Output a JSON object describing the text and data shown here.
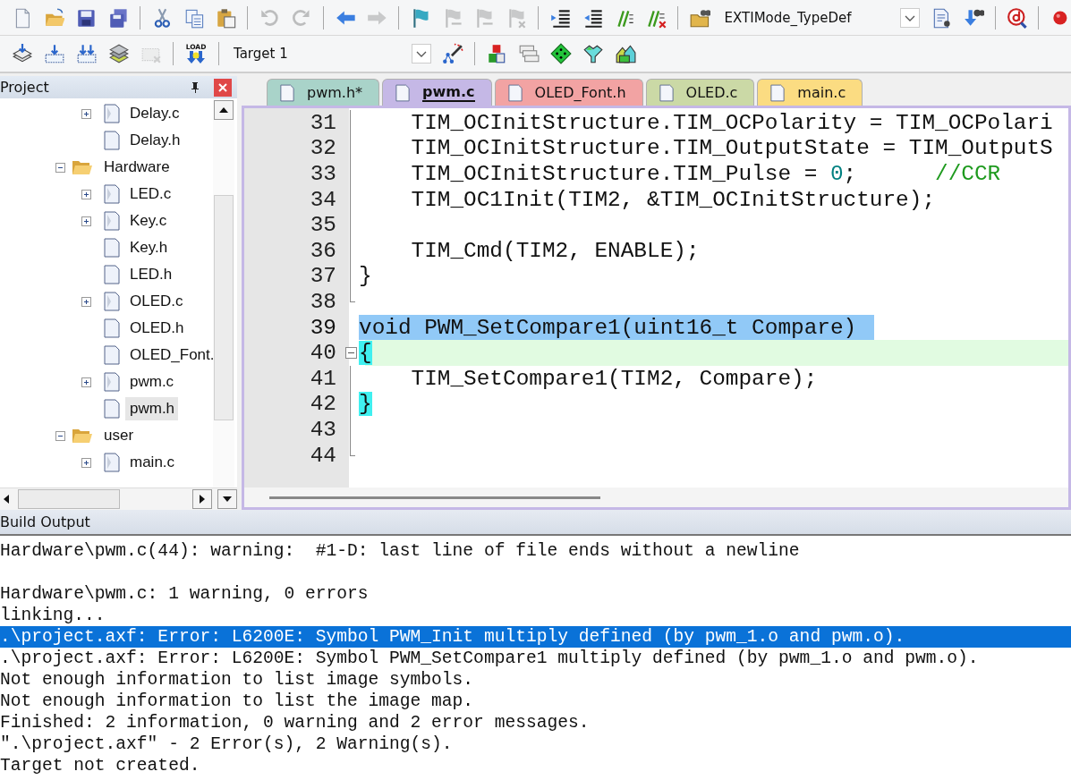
{
  "toolbar_rows": [
    [
      {
        "kind": "new",
        "disabled": false
      },
      {
        "kind": "open",
        "disabled": false
      },
      {
        "kind": "save",
        "disabled": false
      },
      {
        "kind": "save_all",
        "disabled": false
      },
      {
        "kind": "separator"
      },
      {
        "kind": "cut",
        "disabled": false
      },
      {
        "kind": "copy",
        "disabled": false
      },
      {
        "kind": "paste",
        "disabled": false
      },
      {
        "kind": "separator"
      },
      {
        "kind": "undo",
        "disabled": true
      },
      {
        "kind": "redo",
        "disabled": true
      },
      {
        "kind": "separator"
      },
      {
        "kind": "back",
        "disabled": false
      },
      {
        "kind": "forward",
        "disabled": true
      },
      {
        "kind": "separator"
      },
      {
        "kind": "bookmark",
        "disabled": false
      },
      {
        "kind": "prev_bookmark",
        "disabled": true
      },
      {
        "kind": "next_bookmark",
        "disabled": true
      },
      {
        "kind": "clear_bookmarks",
        "disabled": true
      },
      {
        "kind": "separator"
      },
      {
        "kind": "indent",
        "disabled": false
      },
      {
        "kind": "unindent",
        "disabled": false
      },
      {
        "kind": "comment",
        "disabled": false
      },
      {
        "kind": "uncomment",
        "disabled": false
      },
      {
        "kind": "separator"
      },
      {
        "kind": "find_files",
        "disabled": false
      },
      {
        "kind": "combo",
        "value": "EXTIMode_TypeDef"
      },
      {
        "kind": "find",
        "disabled": false
      },
      {
        "kind": "incremental",
        "disabled": false
      },
      {
        "kind": "separator"
      },
      {
        "kind": "debug",
        "disabled": false
      },
      {
        "kind": "separator"
      },
      {
        "kind": "breakpoint",
        "disabled": false
      }
    ],
    [
      {
        "kind": "translate",
        "disabled": false
      },
      {
        "kind": "build",
        "disabled": false
      },
      {
        "kind": "rebuild",
        "disabled": false
      },
      {
        "kind": "batch",
        "disabled": false
      },
      {
        "kind": "stop",
        "disabled": true
      },
      {
        "kind": "separator"
      },
      {
        "kind": "load",
        "label": "LOAD",
        "disabled": false
      },
      {
        "kind": "separator"
      },
      {
        "kind": "combo",
        "value": "Target 1"
      },
      {
        "kind": "options",
        "disabled": false
      },
      {
        "kind": "separator"
      },
      {
        "kind": "manage",
        "disabled": false
      },
      {
        "kind": "windows",
        "disabled": false
      },
      {
        "kind": "diamond",
        "disabled": false
      },
      {
        "kind": "funnel",
        "disabled": false
      },
      {
        "kind": "packs",
        "disabled": false
      }
    ]
  ],
  "project_panel": {
    "title": "Project",
    "tree": {
      "open_group_items": [
        {
          "label": "Delay.c",
          "kind": "source",
          "expanded": false,
          "selected": false
        },
        {
          "label": "Delay.h",
          "kind": "header",
          "selected": false
        }
      ],
      "groups": [
        {
          "label": "Hardware",
          "expanded": true,
          "children": [
            {
              "label": "LED.c",
              "kind": "source",
              "expanded": false,
              "selected": false
            },
            {
              "label": "Key.c",
              "kind": "source",
              "expanded": false,
              "selected": false
            },
            {
              "label": "Key.h",
              "kind": "header",
              "selected": false
            },
            {
              "label": "LED.h",
              "kind": "header",
              "selected": false
            },
            {
              "label": "OLED.c",
              "kind": "source",
              "expanded": false,
              "selected": false
            },
            {
              "label": "OLED.h",
              "kind": "header",
              "selected": false
            },
            {
              "label": "OLED_Font.",
              "kind": "header",
              "selected": false
            },
            {
              "label": "pwm.c",
              "kind": "source",
              "expanded": false,
              "selected": false
            },
            {
              "label": "pwm.h",
              "kind": "header",
              "selected": true
            }
          ]
        },
        {
          "label": "user",
          "expanded": true,
          "children": [
            {
              "label": "main.c",
              "kind": "source",
              "expanded": false,
              "selected": false
            }
          ]
        }
      ]
    }
  },
  "editor": {
    "tabs": [
      {
        "label": "pwm.h*",
        "color": "#a9d3c9",
        "selected": false
      },
      {
        "label": "pwm.c",
        "color": "#c5b8e6",
        "selected": true
      },
      {
        "label": "OLED_Font.h",
        "color": "#f2a3a3",
        "selected": false
      },
      {
        "label": "OLED.c",
        "color": "#cbd9a6",
        "selected": false
      },
      {
        "label": "main.c",
        "color": "#fbdc82",
        "selected": false
      }
    ],
    "lines": [
      {
        "number": "31",
        "fold_box": false,
        "fold_guide": true,
        "fold_end": false,
        "selected": false,
        "current": false,
        "segments": [
          {
            "kind": "plain",
            "text": "    TIM_OCInitStructure.TIM_OCPolarity = TIM_OCPolari"
          }
        ]
      },
      {
        "number": "32",
        "fold_box": false,
        "fold_guide": true,
        "fold_end": false,
        "selected": false,
        "current": false,
        "segments": [
          {
            "kind": "plain",
            "text": "    TIM_OCInitStructure.TIM_OutputState = TIM_OutputS"
          }
        ]
      },
      {
        "number": "33",
        "fold_box": false,
        "fold_guide": true,
        "fold_end": false,
        "selected": false,
        "current": false,
        "segments": [
          {
            "kind": "plain",
            "text": "    TIM_OCInitStructure.TIM_Pulse = "
          },
          {
            "kind": "number",
            "text": "0"
          },
          {
            "kind": "plain",
            "text": ";      "
          },
          {
            "kind": "comment",
            "text": "//CCR"
          }
        ]
      },
      {
        "number": "34",
        "fold_box": false,
        "fold_guide": true,
        "fold_end": false,
        "selected": false,
        "current": false,
        "segments": [
          {
            "kind": "plain",
            "text": "    TIM_OC1Init(TIM2, &TIM_OCInitStructure);"
          }
        ]
      },
      {
        "number": "35",
        "fold_box": false,
        "fold_guide": true,
        "fold_end": false,
        "selected": false,
        "current": false
      },
      {
        "number": "36",
        "fold_box": false,
        "fold_guide": true,
        "fold_end": false,
        "selected": false,
        "current": false,
        "segments": [
          {
            "kind": "plain",
            "text": "    TIM_Cmd(TIM2, ENABLE);"
          }
        ]
      },
      {
        "number": "37",
        "fold_box": false,
        "fold_guide": true,
        "fold_end": false,
        "selected": false,
        "current": false,
        "segments": [
          {
            "kind": "plain",
            "text": "}"
          }
        ]
      },
      {
        "number": "38",
        "fold_box": false,
        "fold_guide": true,
        "fold_end": true,
        "selected": false,
        "current": false
      },
      {
        "number": "39",
        "fold_box": false,
        "fold_guide": false,
        "fold_end": false,
        "selected": true,
        "current": false,
        "segments": [
          {
            "kind": "plain",
            "text": "void PWM_SetCompare1(uint16_t Compare)"
          }
        ]
      },
      {
        "number": "40",
        "fold_box": true,
        "fold_guide": false,
        "fold_end": false,
        "selected": false,
        "current": true,
        "segments": [
          {
            "kind": "brace",
            "text": "{"
          }
        ]
      },
      {
        "number": "41",
        "fold_box": false,
        "fold_guide": true,
        "fold_end": false,
        "selected": false,
        "current": false,
        "segments": [
          {
            "kind": "plain",
            "text": "    TIM_SetCompare1(TIM2, Compare);"
          }
        ]
      },
      {
        "number": "42",
        "fold_box": false,
        "fold_guide": true,
        "fold_end": false,
        "selected": false,
        "current": false,
        "segments": [
          {
            "kind": "brace",
            "text": "}"
          }
        ]
      },
      {
        "number": "43",
        "fold_box": false,
        "fold_guide": true,
        "fold_end": false,
        "selected": false,
        "current": false
      },
      {
        "number": "44",
        "fold_box": false,
        "fold_guide": true,
        "fold_end": true,
        "selected": false,
        "current": false
      }
    ]
  },
  "build_output": {
    "title": "Build Output",
    "lines": [
      {
        "kind": "text",
        "text": "Hardware\\pwm.c(44): warning:  #1-D: last line of file ends without a newline",
        "selected": false
      },
      {
        "kind": "blank"
      },
      {
        "kind": "text",
        "text": "Hardware\\pwm.c: 1 warning, 0 errors",
        "selected": false
      },
      {
        "kind": "text",
        "text": "linking...",
        "selected": false
      },
      {
        "kind": "text",
        "text": ".\\project.axf: Error: L6200E: Symbol PWM_Init multiply defined (by pwm_1.o and pwm.o).",
        "selected": true
      },
      {
        "kind": "text",
        "text": ".\\project.axf: Error: L6200E: Symbol PWM_SetCompare1 multiply defined (by pwm_1.o and pwm.o).",
        "selected": false
      },
      {
        "kind": "text",
        "text": "Not enough information to list image symbols.",
        "selected": false
      },
      {
        "kind": "text",
        "text": "Not enough information to list the image map.",
        "selected": false
      },
      {
        "kind": "text",
        "text": "Finished: 2 information, 0 warning and 2 error messages.",
        "selected": false
      },
      {
        "kind": "text",
        "text": "\".\\project.axf\" - 2 Error(s), 2 Warning(s).",
        "selected": false
      },
      {
        "kind": "text",
        "text": "Target not created.",
        "selected": false
      }
    ]
  }
}
